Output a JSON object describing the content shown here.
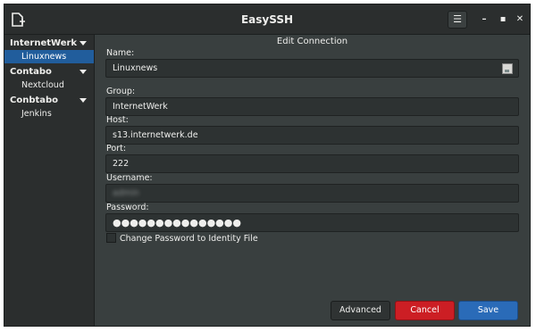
{
  "window": {
    "title": "EasySSH"
  },
  "sidebar": {
    "groups": [
      {
        "label": "InternetWerk",
        "hosts": [
          "Linuxnews"
        ]
      },
      {
        "label": "Contabo",
        "hosts": [
          "Nextcloud"
        ]
      },
      {
        "label": "Conbtabo",
        "hosts": [
          "Jenkins"
        ]
      }
    ],
    "selected_host": "Linuxnews"
  },
  "editor": {
    "heading": "Edit Connection",
    "name_label": "Name:",
    "name_value": "Linuxnews",
    "group_label": "Group:",
    "group_value": "InternetWerk",
    "host_label": "Host:",
    "host_value": "s13.internetwerk.de",
    "port_label": "Port:",
    "port_value": "222",
    "username_label": "Username:",
    "username_value": "admin",
    "password_label": "Password:",
    "password_value": "●●●●●●●●●●●●●●●",
    "checkbox_label": "Change Password to Identity File",
    "checkbox_checked": false
  },
  "buttons": {
    "advanced": "Advanced",
    "cancel": "Cancel",
    "save": "Save"
  },
  "icons": {
    "app": "new-document-icon",
    "menu": "hamburger-menu-icon",
    "minimize": "minimize-icon",
    "maximize": "maximize-icon",
    "close": "close-icon",
    "emoji": "emoji-picker-icon"
  },
  "colors": {
    "selection": "#215d9c",
    "cancel": "#cc1e24",
    "save": "#2a6bb8"
  }
}
